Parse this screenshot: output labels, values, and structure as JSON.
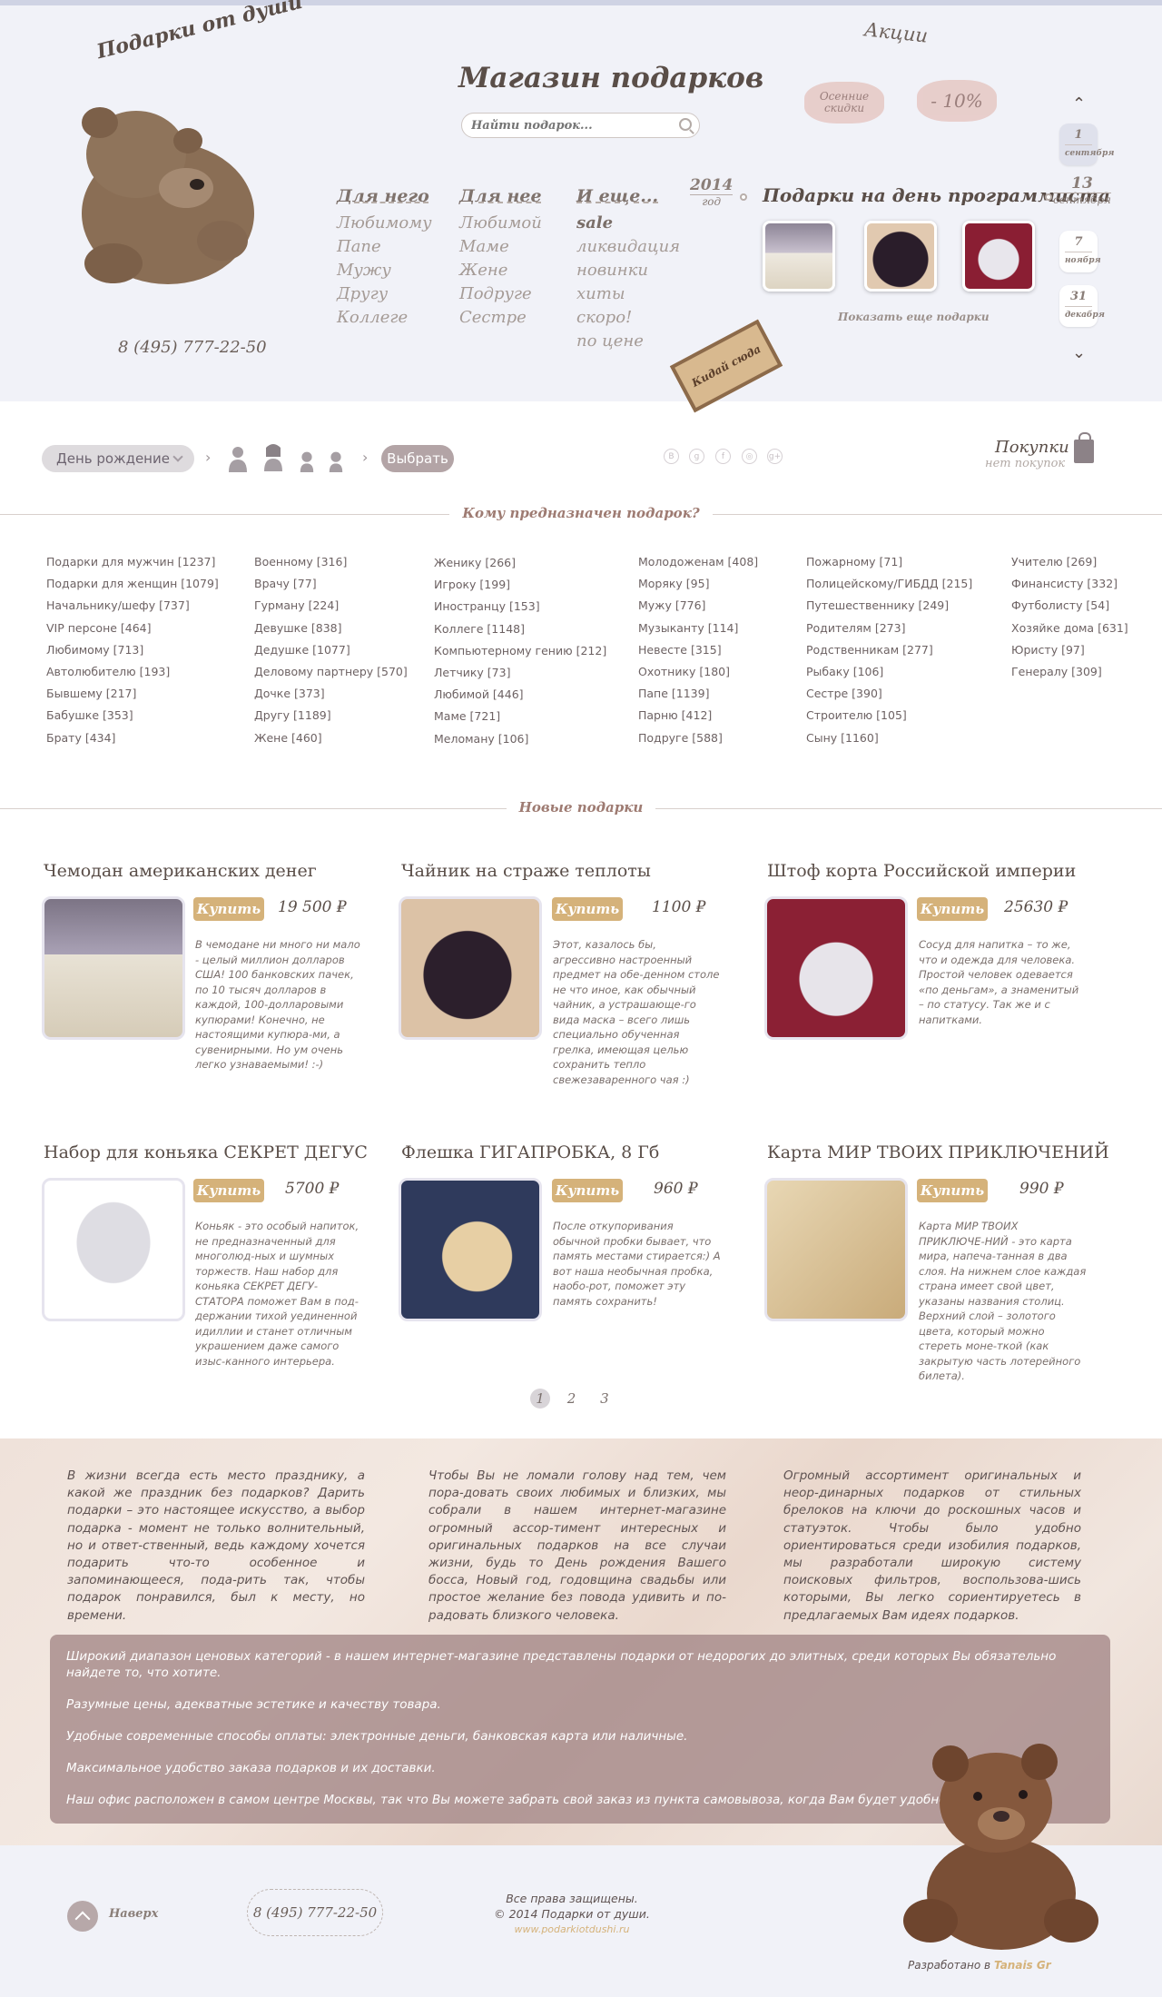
{
  "header": {
    "logo_text": "Подарки от души",
    "phone": "8 (495) 777-22-50",
    "shop_title": "Магазин подарков",
    "search_placeholder": "Найти подарок...",
    "menu": [
      {
        "head": "Для него",
        "items": [
          "Любимому",
          "Папе",
          "Мужу",
          "Другу",
          "Коллеге"
        ]
      },
      {
        "head": "Для нее",
        "items": [
          "Любимой",
          "Маме",
          "Жене",
          "Подруге",
          "Сестре"
        ]
      },
      {
        "head": "И еще...",
        "items": [
          "sale",
          "ликвидация",
          "новинки",
          "хиты",
          "скоро!",
          "по цене"
        ]
      }
    ],
    "promo": {
      "title": "Акции",
      "badge1": "Осенние скидки",
      "badge2": "- 10%"
    },
    "calendar": {
      "year": "2014",
      "year_label": "год",
      "title": "Подарки на день программиста",
      "day": "13",
      "month": "сентября",
      "more_link": "Показать еще подарки",
      "dates": [
        {
          "day": "1",
          "month": "сентября"
        },
        {
          "day": "7",
          "month": "ноября"
        },
        {
          "day": "31",
          "month": "декабря"
        }
      ]
    },
    "where_tag": "Кидай сюда"
  },
  "filter": {
    "occasion": "День рождение",
    "choose": "Выбрать",
    "social": [
      "В",
      "g",
      "f",
      "◎",
      "g+"
    ],
    "cart_title": "Покупки",
    "cart_status": "нет покупок"
  },
  "recipients": {
    "title": "Кому предназначен подарок?",
    "columns": [
      [
        "Подарки для мужчин [1237]",
        "Подарки для женщин [1079]",
        "Начальнику/шефу [737]",
        "VIP персоне [464]",
        "Любимому [713]",
        "Автолюбителю [193]",
        "Бывшему [217]",
        "Бабушке [353]",
        "Брату [434]"
      ],
      [
        "Военному [316]",
        "Врачу [77]",
        "Гурману [224]",
        "Девушке [838]",
        "Дедушке [1077]",
        "Деловому партнеру [570]",
        "Дочке [373]",
        "Другу [1189]",
        "Жене [460]"
      ],
      [
        "Женику [266]",
        "Игроку [199]",
        "Иностранцу [153]",
        "Коллеге [1148]",
        "Компьютерному гению [212]",
        "Летчику [73]",
        "Любимой [446]",
        "Маме [721]",
        "Меломану [106]"
      ],
      [
        "Молодоженам [408]",
        "Моряку [95]",
        "Мужу [776]",
        "Музыканту [114]",
        "Невесте [315]",
        "Охотнику [180]",
        "Папе [1139]",
        "Парню [412]",
        "Подруге [588]"
      ],
      [
        "Пожарному [71]",
        "Полицейскому/ГИБДД [215]",
        "Путешественнику [249]",
        "Родителям [273]",
        "Родственникам [277]",
        "Рыбаку [106]",
        "Сестре [390]",
        "Строителю [105]",
        "Сыну [1160]"
      ],
      [
        "Учителю [269]",
        "Финансисту [332]",
        "Футболисту [54]",
        "Хозяйке дома [631]",
        "Юристу [97]",
        "Генералу [309]"
      ]
    ]
  },
  "new_gifts": {
    "title": "Новые подарки",
    "buy_label": "Купить",
    "products": [
      {
        "title": "Чемодан американских денег",
        "price": "19 500 ₽",
        "desc": "В чемодане ни много ни мало - целый миллион долларов США! 100 банковских пачек, по 10 тысяч долларов в каждой, 100-долларовыми купюрами! Конечно, не настоящими купюра-ми, а сувенирными. Но ум очень легко узнаваемыми! :-)"
      },
      {
        "title": "Чайник на страже теплоты",
        "price": "1100 ₽",
        "desc": "Этот, казалось бы, агрессивно настроенный предмет на обе-денном столе не что иное, как обычный чайник, а устрашающе-го вида маска – всего лишь специально обученная грелка, имеющая целью сохранить тепло свежезаваренного чая :)"
      },
      {
        "title": "Штоф корта Российской империи",
        "price": "25630 ₽",
        "desc": "Сосуд для напитка – то же, что и одежда для человека. Простой человек одевается «по деньгам», а знаменитый – по статусу. Так же и с напитками."
      },
      {
        "title": "Набор для коньяка СЕКРЕТ ДЕГУС",
        "price": "5700 ₽",
        "desc": "Коньяк - это особый напиток, не предназначенный для многолюд-ных и шумных торжеств. Наш набор для коньяка СЕКРЕТ ДЕГУ-СТАТОРА поможет Вам в под-держании тихой уединенной идиллии и станет отличным украшением даже самого изыс-канного интерьера."
      },
      {
        "title": "Флешка ГИГАПРОБКА, 8 Гб",
        "price": "960 ₽",
        "desc": "После откупоривания обычной пробки бывает, что память местами стирается:) А вот наша необычная пробка, наобо-рот, поможет эту память сохранить!"
      },
      {
        "title": "Карта МИР ТВОИХ ПРИКЛЮЧЕНИЙ",
        "price": "990 ₽",
        "desc": "Карта МИР ТВОИХ ПРИКЛЮЧЕ-НИЙ - это карта мира, напеча-танная в два слоя. На нижнем слое каждая страна имеет свой цвет, указаны названия столиц. Верхний слой – золотого цвета, который можно стереть моне-ткой (как закрытую часть лотерейного билета)."
      }
    ],
    "pages": [
      "1",
      "2",
      "3"
    ]
  },
  "about": {
    "columns": [
      "В жизни всегда есть место празднику, а какой же праздник без подарков? Дарить подарки – это настоящее искусство, а выбор подарка - момент не только волнительный, но и ответ-ственный, ведь каждому хочется подарить что-то особенное и запоминающееся, пода-рить так, чтобы подарок понравился, был к месту, но времени.",
      "Чтобы Вы не ломали голову над тем, чем пора-довать своих любимых и близких, мы собрали в нашем интернет-магазине огромный ассор-тимент интересных и оригинальных подарков на все случаи жизни, будь то День рождения Вашего босса, Новый год, годовщина свадьбы или простое желание без повода удивить и по-радовать близкого человека.",
      "Огромный ассортимент оригинальных и неор-динарных подарков от стильных брелоков на ключи до роскошных часов и статуэток. Чтобы было удобно ориентироваться среди изобилия подарков, мы разработали широкую систему поисковых фильтров, воспользова-шись которыми, Вы легко сориентируетесь в предлагаемых Вам идеях подарков."
    ],
    "features": [
      "Широкий диапазон ценовых категорий - в нашем интернет-магазине представлены подарки от недорогих до элитных, среди которых Вы обязательно найдете то, что хотите.",
      "Разумные цены, адекватные эстетике и качеству товара.",
      "Удобные современные способы оплаты: электронные деньги, банковская карта или наличные.",
      "Максимальное удобство заказа подарков и их доставки.",
      "Наш офис расположен в самом центре Москвы, так что Вы можете забрать свой заказ из пункта самовывоза, когда Вам будет удобно."
    ]
  },
  "footer": {
    "up_label": "Наверх",
    "phone": "8 (495) 777-22-50",
    "rights": "Все права защищены.",
    "copyright": "© 2014 Подарки от души.",
    "site": "www.podarkiotdushi.ru",
    "dev_prefix": "Разработано в",
    "dev_name": "Tanais Gr"
  },
  "colors": {
    "accent_gold": "#d5b27a",
    "brown_text": "#5a4e48",
    "header_bg": "#f1f2f8",
    "choose_btn": "#b3a4a6"
  }
}
